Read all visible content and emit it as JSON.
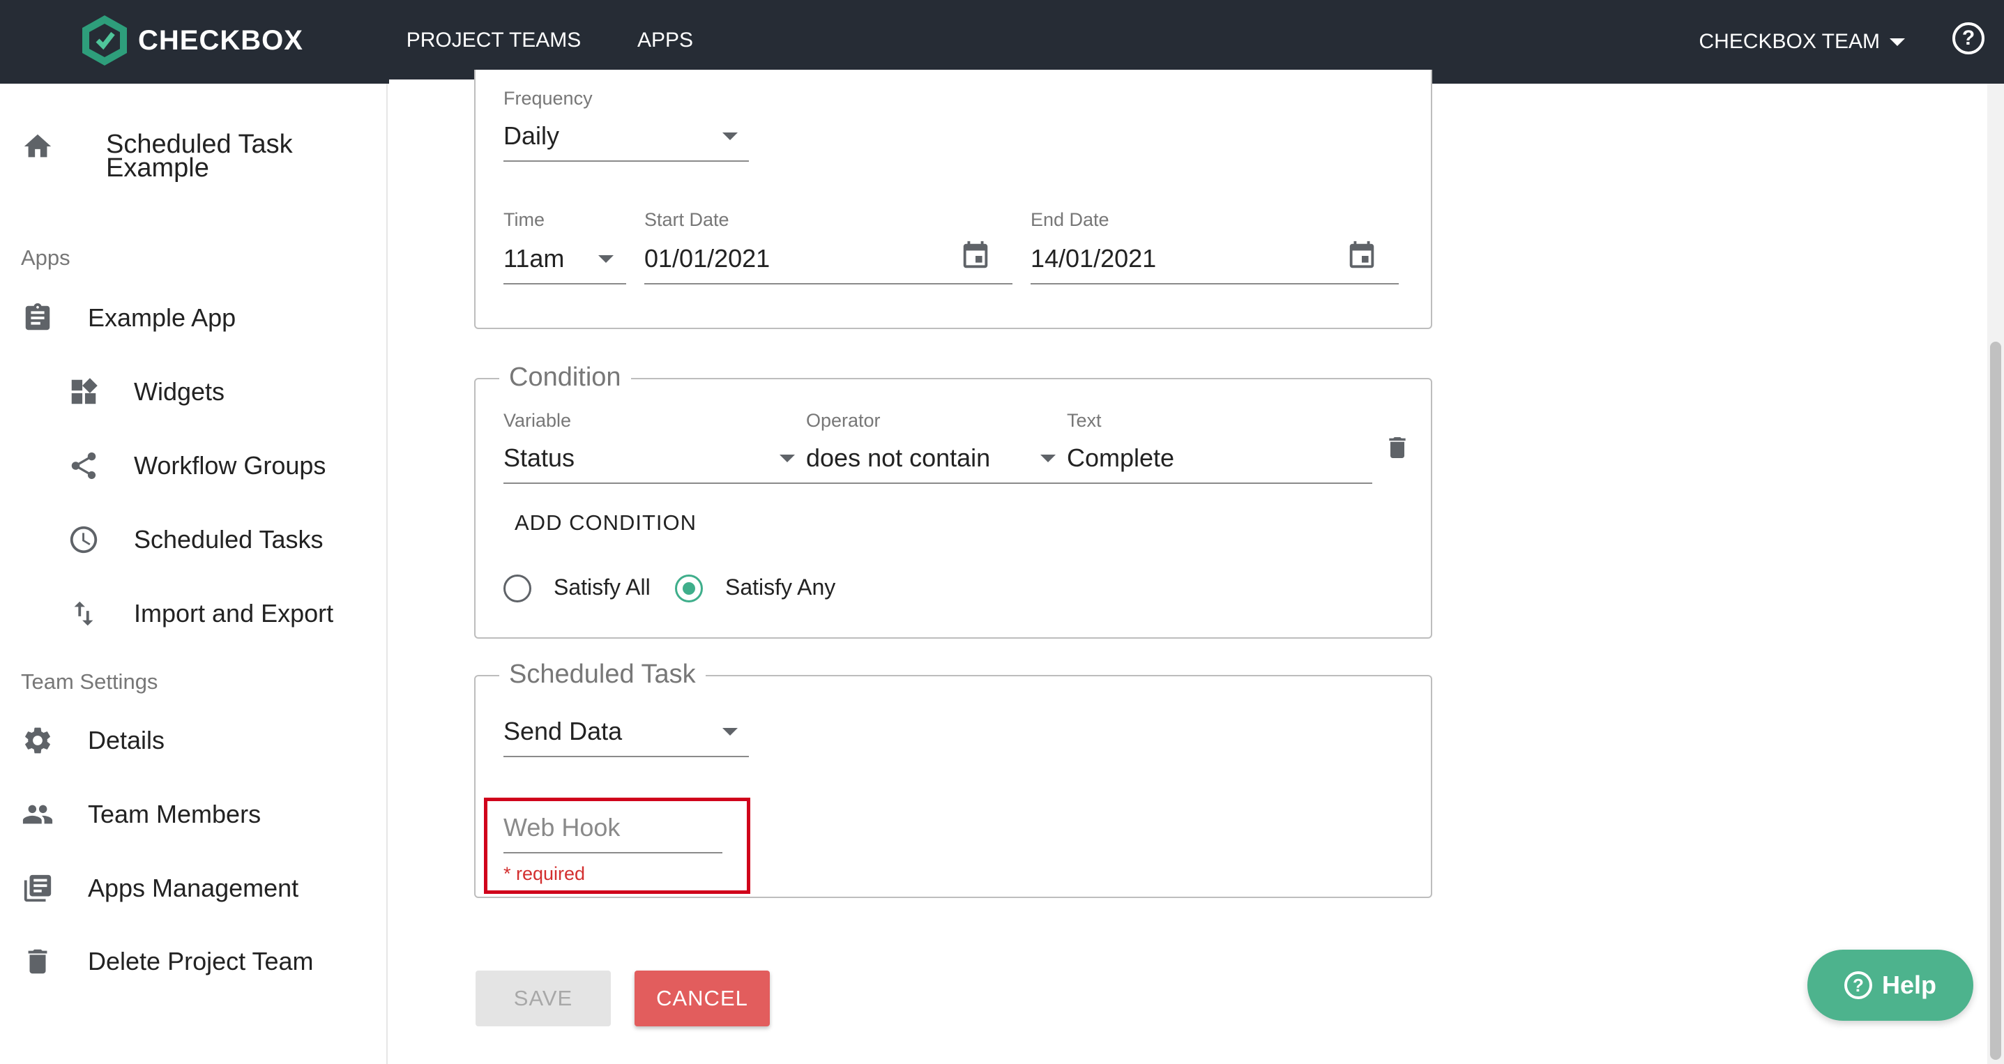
{
  "app": {
    "brand": "CHECKBOX"
  },
  "topnav": {
    "tabs": [
      {
        "label": "PROJECT TEAMS",
        "active": true
      },
      {
        "label": "APPS",
        "active": false
      }
    ],
    "team_menu": "CHECKBOX TEAM",
    "help_glyph": "?"
  },
  "sidebar": {
    "project_name_line1": "Scheduled Task",
    "project_name_line2": "Example",
    "apps_section": "Apps",
    "app_name": "Example App",
    "app_items": [
      {
        "label": "Widgets",
        "icon": "widgets-icon"
      },
      {
        "label": "Workflow Groups",
        "icon": "share-icon"
      },
      {
        "label": "Scheduled Tasks",
        "icon": "clock-icon"
      },
      {
        "label": "Import and Export",
        "icon": "import-export-icon"
      }
    ],
    "team_section": "Team Settings",
    "team_items": [
      {
        "label": "Details",
        "icon": "gear-icon"
      },
      {
        "label": "Team Members",
        "icon": "people-icon"
      },
      {
        "label": "Apps Management",
        "icon": "library-icon"
      },
      {
        "label": "Delete Project Team",
        "icon": "trash-icon"
      }
    ]
  },
  "schedule": {
    "frequency_label": "Frequency",
    "frequency_value": "Daily",
    "time_label": "Time",
    "time_value": "11am",
    "start_label": "Start Date",
    "start_value": "01/01/2021",
    "end_label": "End Date",
    "end_value": "14/01/2021"
  },
  "condition": {
    "legend": "Condition",
    "variable_label": "Variable",
    "variable_value": "Status",
    "operator_label": "Operator",
    "operator_value": "does not contain",
    "text_label": "Text",
    "text_value": "Complete",
    "add_condition": "ADD CONDITION",
    "satisfy_all": "Satisfy All",
    "satisfy_any": "Satisfy Any",
    "selected": "Satisfy Any"
  },
  "task": {
    "legend": "Scheduled Task",
    "action_value": "Send Data",
    "webhook_placeholder": "Web Hook",
    "webhook_value": "",
    "webhook_error": "* required"
  },
  "actions": {
    "save": "SAVE",
    "cancel": "CANCEL"
  },
  "help_widget": {
    "label": "Help",
    "glyph": "?"
  },
  "colors": {
    "topbar": "#262c35",
    "accent": "#3fae8b",
    "cancel": "#e25d5d",
    "error": "#d0021b"
  }
}
